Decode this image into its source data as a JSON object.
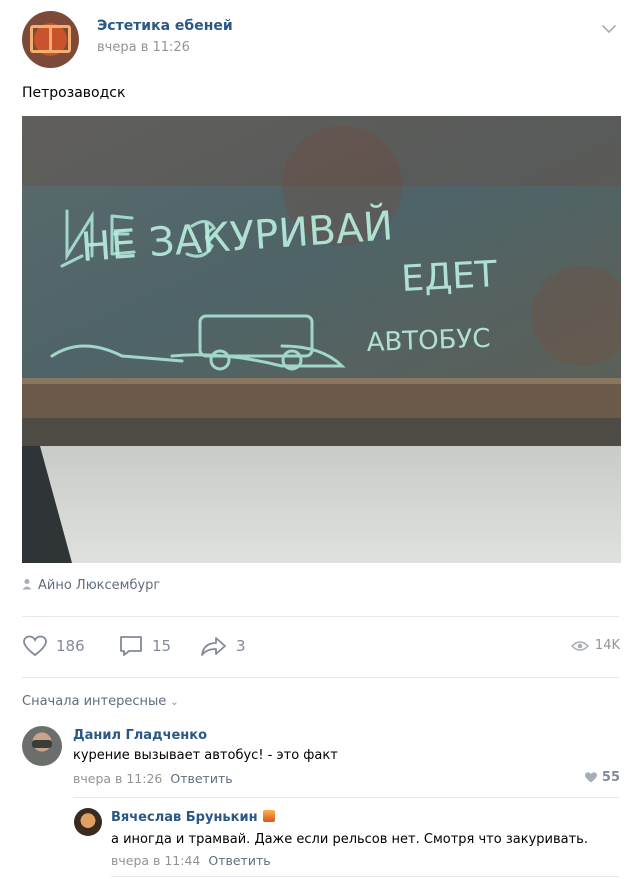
{
  "post": {
    "group_name": "Эстетика ебеней",
    "time": "вчера в 11:26",
    "text": "Петрозаводск",
    "photo_author": "Айно Люксембург",
    "photo_inscriptions": [
      "НЕ ЗАКУРИВАЙ",
      "ЕДЕТ",
      "АВТОБУС"
    ]
  },
  "actions": {
    "likes": "186",
    "comments": "15",
    "shares": "3",
    "views": "14K"
  },
  "comments_section": {
    "sort_label": "Сначала интересные",
    "comments": [
      {
        "author": "Данил Гладченко",
        "text": "курение вызывает автобус! - это факт",
        "time": "вчера в 11:26",
        "reply_label": "Ответить",
        "likes": "55"
      },
      {
        "author": "Вячеслав Брунькин",
        "text": "а иногда и трамвай. Даже если рельсов нет. Смотря что закуривать.",
        "time": "вчера в 11:44",
        "reply_label": "Ответить"
      }
    ]
  },
  "colors": {
    "link": "#2a5885",
    "muted": "#939393",
    "icon": "#828a99",
    "divider": "#e7e8ec"
  }
}
